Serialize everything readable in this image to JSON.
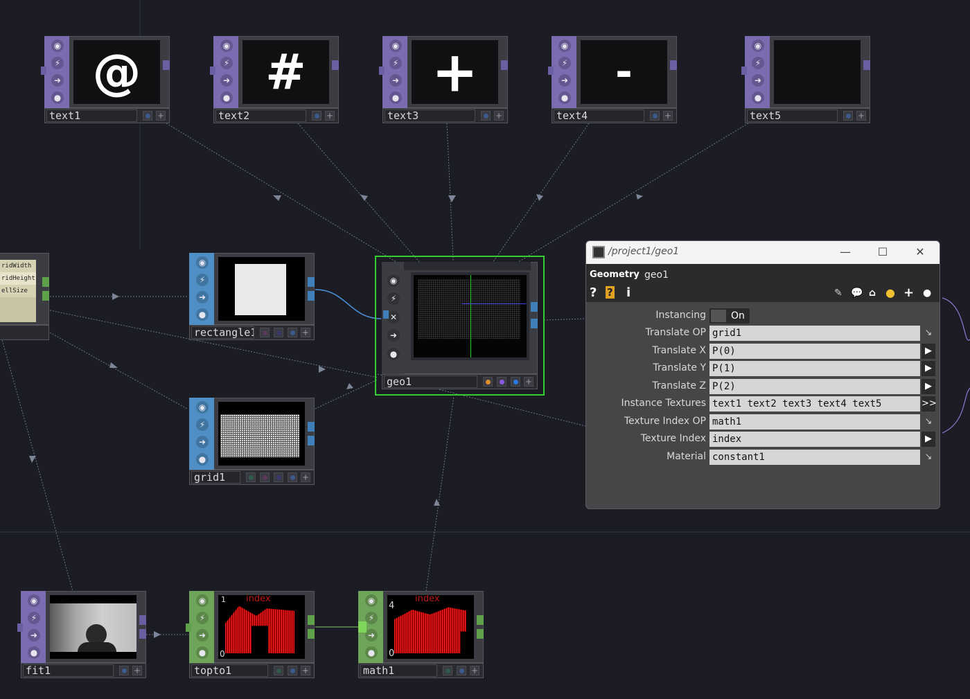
{
  "nodes": {
    "text1": {
      "name": "text1",
      "glyph": "@"
    },
    "text2": {
      "name": "text2",
      "glyph": "#"
    },
    "text3": {
      "name": "text3",
      "glyph": "+"
    },
    "text4": {
      "name": "text4",
      "glyph": "-"
    },
    "text5": {
      "name": "text5",
      "glyph": ""
    },
    "rectangle1": {
      "name": "rectangle1"
    },
    "grid1": {
      "name": "grid1"
    },
    "geo1": {
      "name": "geo1"
    },
    "fit1": {
      "name": "fit1"
    },
    "topto1": {
      "name": "topto1",
      "chan_label": "index",
      "top_value": "1",
      "bottom_value": "0"
    },
    "math1": {
      "name": "math1",
      "chan_label": "index",
      "top_value": "4",
      "bottom_value": "0"
    },
    "partial": {
      "labels": [
        "ridWidth",
        "ridHeight",
        "ellSize"
      ]
    }
  },
  "panel": {
    "window_title": "/project1/geo1",
    "op_type": "Geometry",
    "op_name": "geo1",
    "params": [
      {
        "label": "Instancing",
        "kind": "toggle",
        "value": "On"
      },
      {
        "label": "Translate OP",
        "value": "grid1",
        "button": "op"
      },
      {
        "label": "Translate X",
        "value": "P(0)",
        "button": "▶"
      },
      {
        "label": "Translate Y",
        "value": "P(1)",
        "button": "▶"
      },
      {
        "label": "Translate Z",
        "value": "P(2)",
        "button": "▶"
      },
      {
        "label": "Instance Textures",
        "value": "text1  text2  text3  text4  text5",
        "button": ">>"
      },
      {
        "label": "Texture Index OP",
        "value": "math1",
        "button": "op"
      },
      {
        "label": "Texture Index",
        "value": "index",
        "button": "▶"
      },
      {
        "label": "Material",
        "value": "constant1",
        "button": "op"
      }
    ]
  },
  "colors": {
    "selected_outline": "#2fd12f",
    "top_family": "#7b6bb0",
    "chop_family": "#6fa55a",
    "texture_family": "#4f8fc5",
    "wire": "#8a95a8",
    "data_wire": "#4a90d9"
  }
}
